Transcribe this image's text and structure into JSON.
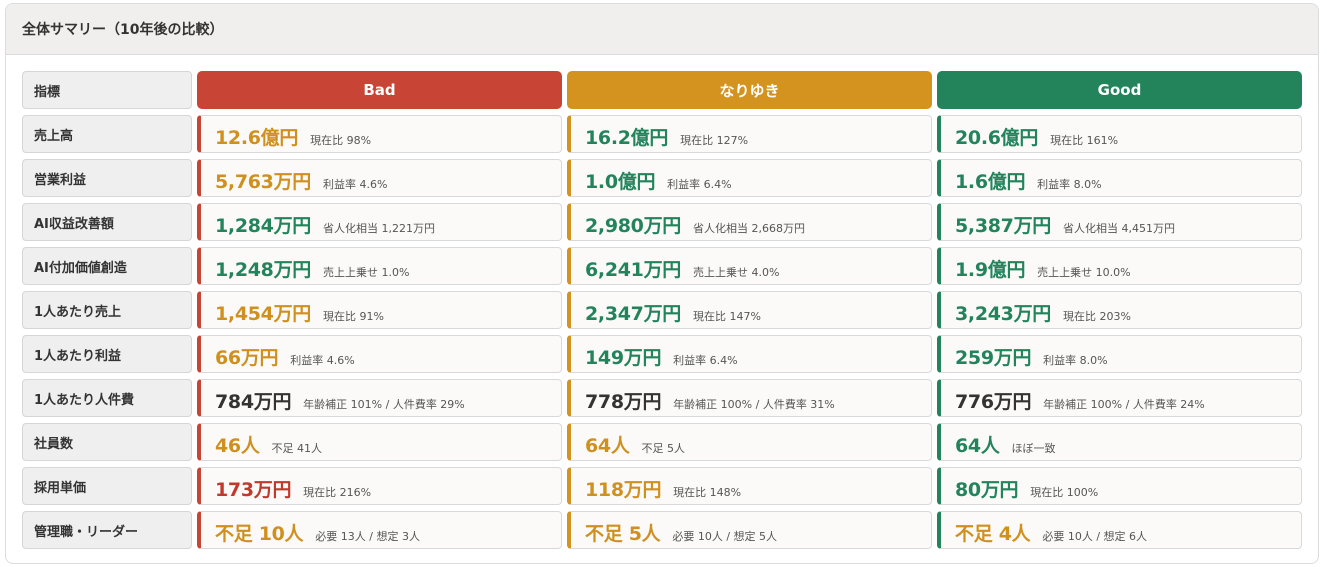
{
  "title": "全体サマリー（10年後の比較）",
  "corner_label": "指標",
  "scenarios": [
    {
      "key": "bad",
      "label": "Bad",
      "color": "#c84536"
    },
    {
      "key": "nari",
      "label": "なりゆき",
      "color": "#d4921e"
    },
    {
      "key": "good",
      "label": "Good",
      "color": "#23845c"
    }
  ],
  "tone_colors": {
    "orange": "#d0901f",
    "green": "#23845c",
    "red": "#c0392b",
    "dark": "#333333"
  },
  "rows": [
    {
      "label": "売上高",
      "cells": [
        {
          "value": "12.6億円",
          "note": "現在比 98%",
          "tone": "orange"
        },
        {
          "value": "16.2億円",
          "note": "現在比 127%",
          "tone": "green"
        },
        {
          "value": "20.6億円",
          "note": "現在比 161%",
          "tone": "green"
        }
      ]
    },
    {
      "label": "営業利益",
      "cells": [
        {
          "value": "5,763万円",
          "note": "利益率 4.6%",
          "tone": "orange"
        },
        {
          "value": "1.0億円",
          "note": "利益率 6.4%",
          "tone": "green"
        },
        {
          "value": "1.6億円",
          "note": "利益率 8.0%",
          "tone": "green"
        }
      ]
    },
    {
      "label": "AI収益改善額",
      "cells": [
        {
          "value": "1,284万円",
          "note": "省人化相当 1,221万円",
          "tone": "green"
        },
        {
          "value": "2,980万円",
          "note": "省人化相当 2,668万円",
          "tone": "green"
        },
        {
          "value": "5,387万円",
          "note": "省人化相当 4,451万円",
          "tone": "green"
        }
      ]
    },
    {
      "label": "AI付加価値創造",
      "cells": [
        {
          "value": "1,248万円",
          "note": "売上上乗せ 1.0%",
          "tone": "green"
        },
        {
          "value": "6,241万円",
          "note": "売上上乗せ 4.0%",
          "tone": "green"
        },
        {
          "value": "1.9億円",
          "note": "売上上乗せ 10.0%",
          "tone": "green"
        }
      ]
    },
    {
      "label": "1人あたり売上",
      "cells": [
        {
          "value": "1,454万円",
          "note": "現在比 91%",
          "tone": "orange"
        },
        {
          "value": "2,347万円",
          "note": "現在比 147%",
          "tone": "green"
        },
        {
          "value": "3,243万円",
          "note": "現在比 203%",
          "tone": "green"
        }
      ]
    },
    {
      "label": "1人あたり利益",
      "cells": [
        {
          "value": "66万円",
          "note": "利益率 4.6%",
          "tone": "orange"
        },
        {
          "value": "149万円",
          "note": "利益率 6.4%",
          "tone": "green"
        },
        {
          "value": "259万円",
          "note": "利益率 8.0%",
          "tone": "green"
        }
      ]
    },
    {
      "label": "1人あたり人件費",
      "cells": [
        {
          "value": "784万円",
          "note": "年齢補正 101% / 人件費率 29%",
          "tone": "dark"
        },
        {
          "value": "778万円",
          "note": "年齢補正 100% / 人件費率 31%",
          "tone": "dark"
        },
        {
          "value": "776万円",
          "note": "年齢補正 100% / 人件費率 24%",
          "tone": "dark"
        }
      ]
    },
    {
      "label": "社員数",
      "cells": [
        {
          "value": "46人",
          "note": "不足 41人",
          "tone": "orange"
        },
        {
          "value": "64人",
          "note": "不足 5人",
          "tone": "orange"
        },
        {
          "value": "64人",
          "note": "ほぼ一致",
          "tone": "green"
        }
      ]
    },
    {
      "label": "採用単価",
      "cells": [
        {
          "value": "173万円",
          "note": "現在比 216%",
          "tone": "red"
        },
        {
          "value": "118万円",
          "note": "現在比 148%",
          "tone": "orange"
        },
        {
          "value": "80万円",
          "note": "現在比 100%",
          "tone": "green"
        }
      ]
    },
    {
      "label": "管理職・リーダー",
      "cells": [
        {
          "value": "不足 10人",
          "note": "必要 13人 / 想定 3人",
          "tone": "orange"
        },
        {
          "value": "不足 5人",
          "note": "必要 10人 / 想定 5人",
          "tone": "orange"
        },
        {
          "value": "不足 4人",
          "note": "必要 10人 / 想定 6人",
          "tone": "orange"
        }
      ]
    }
  ]
}
